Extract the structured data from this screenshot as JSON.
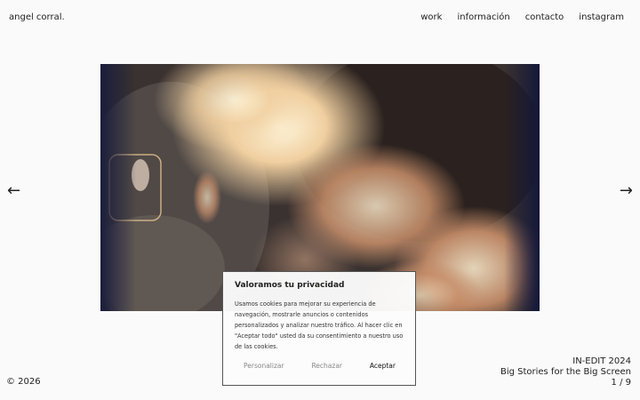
{
  "header": {
    "brand": "angel corral.",
    "nav": [
      "work",
      "información",
      "contacto",
      "instagram"
    ]
  },
  "slider": {
    "prev_arrow": "←",
    "next_arrow": "→",
    "caption": {
      "line1": "IN-EDIT 2024",
      "line2": "Big Stories for the Big Screen",
      "counter": "1 / 9"
    }
  },
  "footer": {
    "copyright": "© 2026"
  },
  "cookie_banner": {
    "title": "Valoramos tu privacidad",
    "text": "Usamos cookies para mejorar su experiencia de navegación, mostrarle anuncios o contenidos personalizados y analizar nuestro tráfico. Al hacer clic en \"Aceptar todo\" usted da su consentimiento a nuestro uso de las cookies.",
    "buttons": {
      "customize": "Personalizar",
      "reject": "Rechazar",
      "accept": "Aceptar"
    }
  },
  "colors": {
    "background": "#fafafa",
    "text": "#222222",
    "muted_button": "#888888"
  }
}
